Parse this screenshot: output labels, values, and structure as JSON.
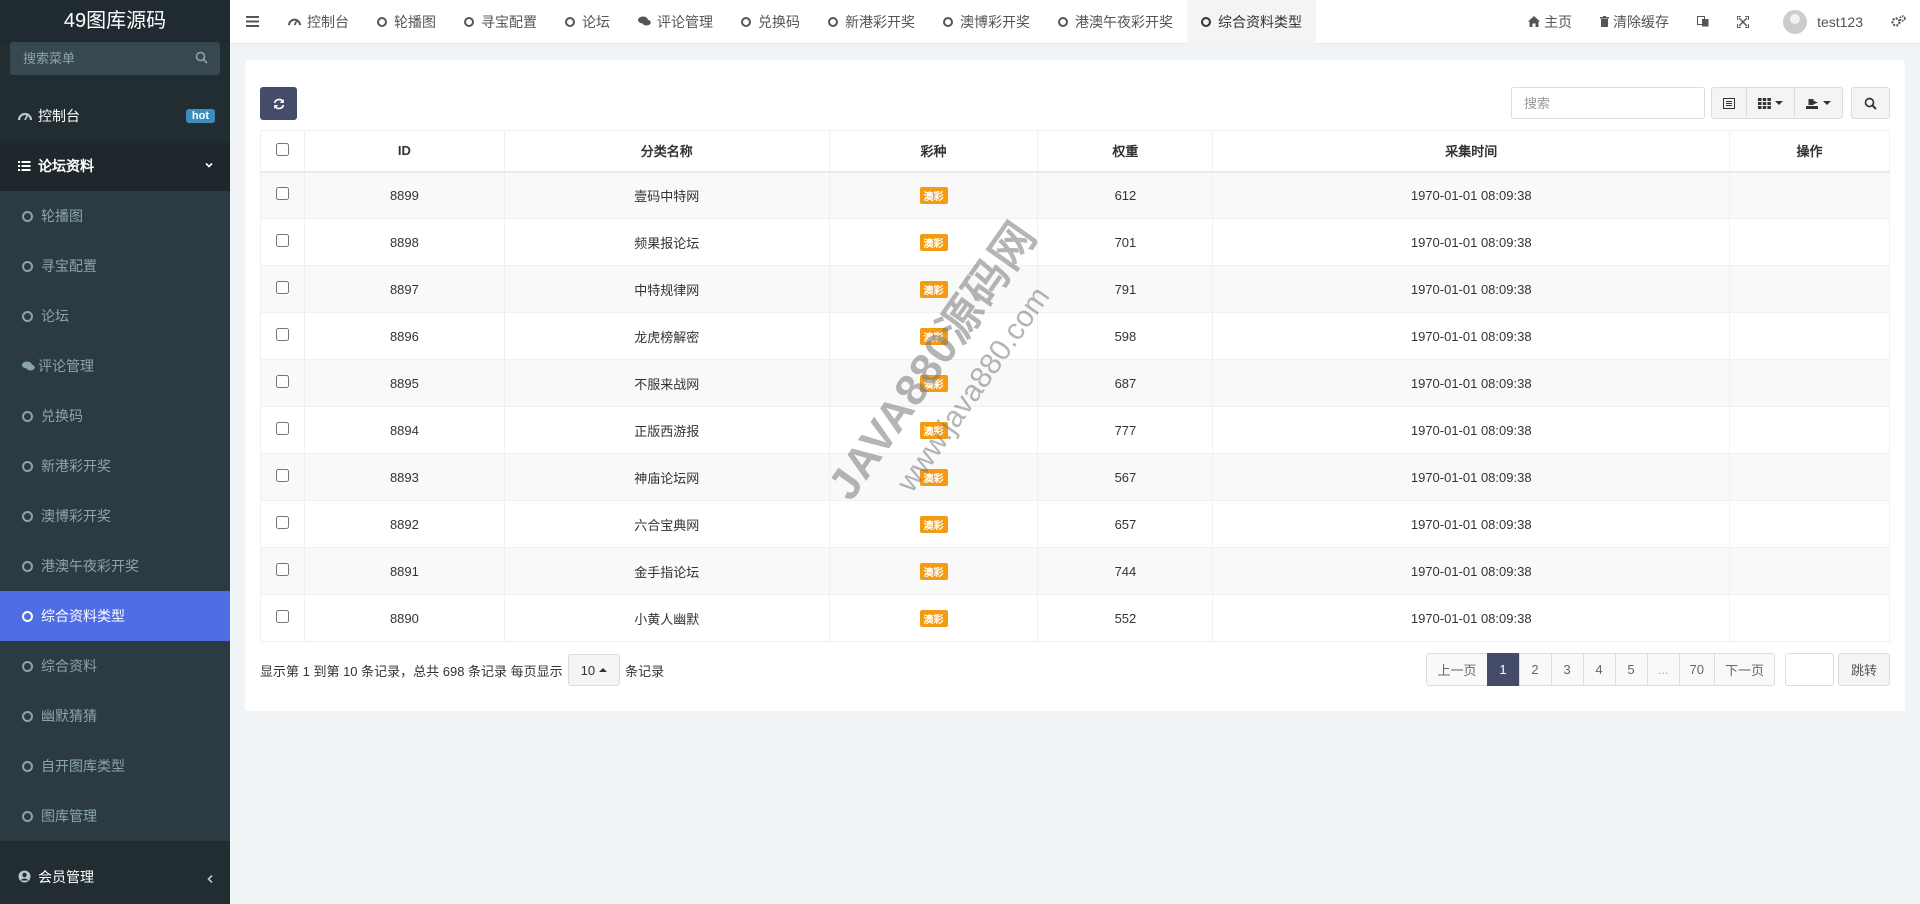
{
  "app": {
    "logo": "49图库源码"
  },
  "sidebar": {
    "search_placeholder": "搜索菜单",
    "dashboard": "控制台",
    "hot_badge": "hot",
    "forum_group": "论坛资料",
    "items": [
      {
        "label": "轮播图"
      },
      {
        "label": "寻宝配置"
      },
      {
        "label": "论坛"
      },
      {
        "label": "评论管理"
      },
      {
        "label": "兑换码"
      },
      {
        "label": "新港彩开奖"
      },
      {
        "label": "澳博彩开奖"
      },
      {
        "label": "港澳午夜彩开奖"
      },
      {
        "label": "综合资料类型"
      },
      {
        "label": "综合资料"
      },
      {
        "label": "幽默猜猜"
      },
      {
        "label": "自开图库类型"
      },
      {
        "label": "图库管理"
      }
    ],
    "member": "会员管理"
  },
  "topbar": {
    "tabs": [
      "控制台",
      "轮播图",
      "寻宝配置",
      "论坛",
      "评论管理",
      "兑换码",
      "新港彩开奖",
      "澳博彩开奖",
      "港澳午夜彩开奖",
      "综合资料类型"
    ],
    "home": "主页",
    "clear_cache": "清除缓存",
    "username": "test123"
  },
  "toolbar": {
    "search_placeholder": "搜索"
  },
  "table": {
    "headers": [
      "ID",
      "分类名称",
      "彩种",
      "权重",
      "采集时间",
      "操作"
    ],
    "rows": [
      {
        "id": "8899",
        "name": "壹码中特网",
        "type": "澳彩",
        "weight": "612",
        "time": "1970-01-01 08:09:38"
      },
      {
        "id": "8898",
        "name": "频果报论坛",
        "type": "澳彩",
        "weight": "701",
        "time": "1970-01-01 08:09:38"
      },
      {
        "id": "8897",
        "name": "中特规律网",
        "type": "澳彩",
        "weight": "791",
        "time": "1970-01-01 08:09:38"
      },
      {
        "id": "8896",
        "name": "龙虎榜解密",
        "type": "澳彩",
        "weight": "598",
        "time": "1970-01-01 08:09:38"
      },
      {
        "id": "8895",
        "name": "不服来战网",
        "type": "澳彩",
        "weight": "687",
        "time": "1970-01-01 08:09:38"
      },
      {
        "id": "8894",
        "name": "正版西游报",
        "type": "澳彩",
        "weight": "777",
        "time": "1970-01-01 08:09:38"
      },
      {
        "id": "8893",
        "name": "神庙论坛网",
        "type": "澳彩",
        "weight": "567",
        "time": "1970-01-01 08:09:38"
      },
      {
        "id": "8892",
        "name": "六合宝典网",
        "type": "澳彩",
        "weight": "657",
        "time": "1970-01-01 08:09:38"
      },
      {
        "id": "8891",
        "name": "金手指论坛",
        "type": "澳彩",
        "weight": "744",
        "time": "1970-01-01 08:09:38"
      },
      {
        "id": "8890",
        "name": "小黄人幽默",
        "type": "澳彩",
        "weight": "552",
        "time": "1970-01-01 08:09:38"
      }
    ]
  },
  "footer": {
    "info_prefix": "显示第 1 到第 10 条记录，总共 698 条记录 每页显示",
    "page_size": "10",
    "info_suffix": "条记录",
    "prev": "上一页",
    "pages": [
      "1",
      "2",
      "3",
      "4",
      "5",
      "...",
      "70"
    ],
    "next": "下一页",
    "jump": "跳转"
  },
  "watermark": {
    "line1": "JAVA880源码网",
    "line2": "www.java880.com"
  },
  "colors": {
    "sidebar": "#222d32",
    "active": "#4f6ee4",
    "primary_btn": "#444c69",
    "tag": "#f39c12",
    "hot": "#3c8dbc"
  }
}
